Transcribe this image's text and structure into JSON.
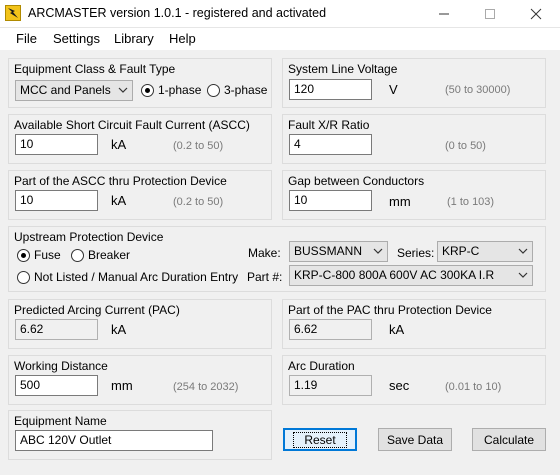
{
  "window": {
    "title": "ARCMASTER version 1.0.1 - registered and activated",
    "icon": "arc-lightning-icon",
    "controls": {
      "minimize": "—",
      "maximize": "☐",
      "close": "✕"
    }
  },
  "menu": [
    "File",
    "Settings",
    "Library",
    "Help"
  ],
  "equipment": {
    "title": "Equipment Class & Fault Type",
    "class_value": "MCC and Panels",
    "phase_1": "1-phase",
    "phase_3": "3-phase",
    "selected_phase": "1-phase"
  },
  "voltage": {
    "title": "System Line Voltage",
    "value": "120",
    "unit": "V",
    "range": "(50 to 30000)"
  },
  "ascc": {
    "title": "Available Short Circuit Fault Current (ASCC)",
    "value": "10",
    "unit": "kA",
    "range": "(0.2 to 50)"
  },
  "xr": {
    "title": "Fault X/R Ratio",
    "value": "4",
    "range": "(0 to 50)"
  },
  "ascc_part": {
    "title": "Part of the ASCC thru Protection Device",
    "value": "10",
    "unit": "kA",
    "range": "(0.2 to 50)"
  },
  "gap": {
    "title": "Gap between Conductors",
    "value": "10",
    "unit": "mm",
    "range": "(1 to 103)"
  },
  "upstream": {
    "title": "Upstream Protection Device",
    "fuse": "Fuse",
    "breaker": "Breaker",
    "not_listed": "Not Listed / Manual Arc Duration Entry",
    "selected": "Fuse",
    "make_label": "Make:",
    "make_value": "BUSSMANN",
    "series_label": "Series:",
    "series_value": "KRP-C",
    "part_label": "Part #:",
    "part_value": "KRP-C-800 800A 600V AC 300KA I.R"
  },
  "pac": {
    "title": "Predicted Arcing Current (PAC)",
    "value": "6.62",
    "unit": "kA"
  },
  "pac_part": {
    "title": "Part of the PAC thru Protection Device",
    "value": "6.62",
    "unit": "kA"
  },
  "working": {
    "title": "Working Distance",
    "value": "500",
    "unit": "mm",
    "range": "(254 to 2032)"
  },
  "arc": {
    "title": "Arc Duration",
    "value": "1.19",
    "unit": "sec",
    "range": "(0.01 to 10)"
  },
  "equip_name": {
    "title": "Equipment Name",
    "value": "ABC 120V Outlet"
  },
  "buttons": {
    "reset": "Reset",
    "save": "Save Data",
    "calculate": "Calculate"
  },
  "colors": {
    "window_bg": "#f0f0f0",
    "focus_border": "#0078d7",
    "range_text": "#7a7a7a"
  }
}
